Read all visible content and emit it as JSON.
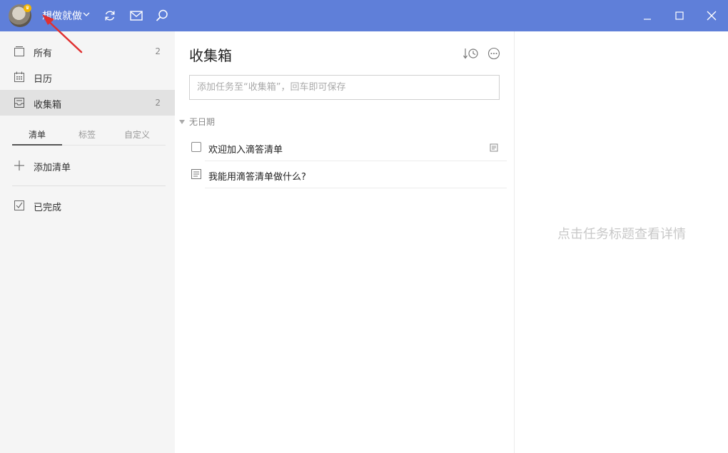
{
  "titlebar": {
    "username": "想做就做",
    "icons": [
      "refresh-icon",
      "mail-icon",
      "search-icon"
    ],
    "window_controls": [
      "minimize-icon",
      "maximize-icon",
      "close-icon"
    ],
    "bg_color": "#5f7fd9"
  },
  "sidebar": {
    "items": [
      {
        "label": "所有",
        "count": "2",
        "icon": "all-tasks-icon"
      },
      {
        "label": "日历",
        "count": "",
        "icon": "calendar-icon"
      },
      {
        "label": "收集箱",
        "count": "2",
        "icon": "inbox-icon"
      }
    ],
    "tabs": [
      {
        "label": "清单"
      },
      {
        "label": "标签"
      },
      {
        "label": "自定义"
      }
    ],
    "add_list_label": "添加清单",
    "completed_label": "已完成"
  },
  "list": {
    "title": "收集箱",
    "input_placeholder": "添加任务至“收集箱”，回车即可保存",
    "section_label": "无日期",
    "tasks": [
      {
        "title": "欢迎加入滴答清单",
        "has_note": true
      },
      {
        "title": "我能用滴答清单做什么?",
        "has_note": false
      }
    ]
  },
  "detail": {
    "empty_hint": "点击任务标题查看详情"
  },
  "annotation": {
    "arrow_color": "#e03030"
  }
}
